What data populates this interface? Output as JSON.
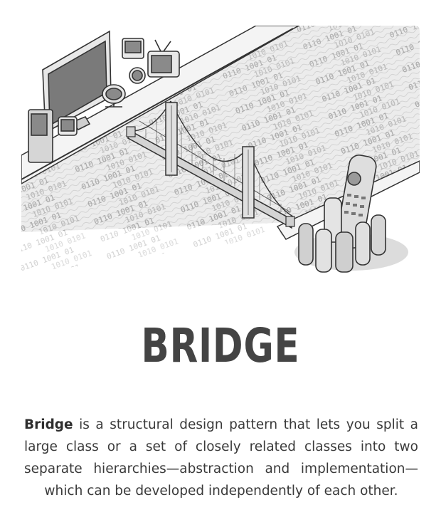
{
  "pattern": {
    "title": "BRIDGE",
    "description_lead": "Bridge",
    "description_rest": " is a structural design pattern that lets you split a large class or a set of closely related classes into two separate hierarchies—abstraction and implementation—which can be developed independently of each other."
  },
  "illustration": {
    "icon": "bridge-illustration",
    "binary_text": "0101 1001 0110 0011 1010 0101 1100 0010 1011 0110 1001 0100 0111 1010"
  },
  "colors": {
    "title": "#444444",
    "text": "#3a3a3a",
    "sketch_stroke": "#333333",
    "water": "#e6e6e6",
    "bank": "#f2f2f2"
  }
}
